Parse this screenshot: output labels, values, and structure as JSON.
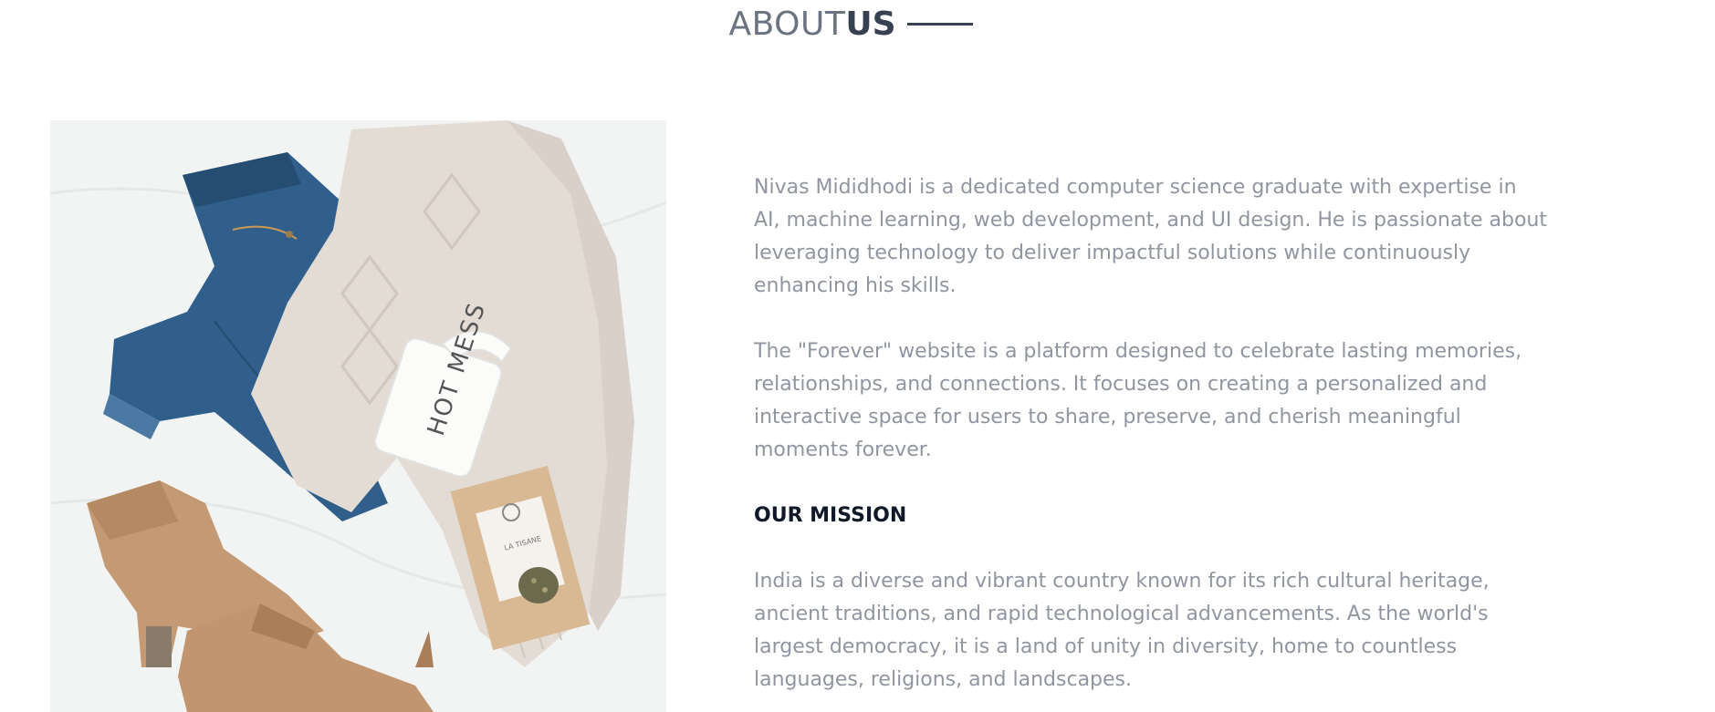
{
  "header": {
    "title_light": "ABOUT",
    "title_bold": "US"
  },
  "image": {
    "icon": "product-flatlay-image",
    "mug_text": "HOT MESS",
    "tea_label": "LA TISANE"
  },
  "about": {
    "paragraph_1": "Nivas Mididhodi is a dedicated computer science graduate with expertise in AI, machine learning, web development, and UI design. He is passionate about leveraging technology to deliver impactful solutions while continuously enhancing his skills.",
    "paragraph_2": "The \"Forever\" website is a platform designed to celebrate lasting memories, relationships, and connections. It focuses on creating a personalized and interactive space for users to share, preserve, and cherish meaningful moments forever.",
    "mission_heading": "OUR MISSION",
    "mission_text": "India is a diverse and vibrant country known for its rich cultural heritage, ancient traditions, and rapid technological advancements. As the world's largest democracy, it is a land of unity in diversity, home to countless languages, religions, and landscapes."
  },
  "colors": {
    "body_text": "#9095a0",
    "heading_text": "#111827",
    "title_light": "#6b7280",
    "title_dark": "#374151"
  }
}
